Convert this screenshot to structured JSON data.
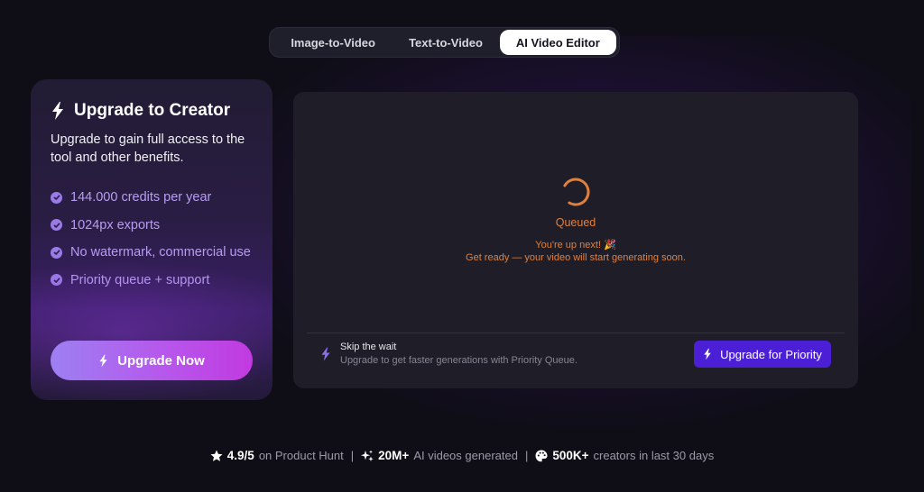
{
  "tabs": [
    {
      "label": "Image-to-Video"
    },
    {
      "label": "Text-to-Video"
    },
    {
      "label": "AI Video Editor",
      "active": true
    }
  ],
  "upsell": {
    "title": "Upgrade to Creator",
    "description": "Upgrade to gain full access to the tool and other benefits.",
    "benefits": [
      "144.000 credits per year",
      "1024px exports",
      "No watermark, commercial use",
      "Priority queue + support"
    ],
    "button_label": "Upgrade Now"
  },
  "queue": {
    "status": "Queued",
    "line1": "You're up next! 🎉",
    "line2": "Get ready — your video will start generating soon.",
    "skip_title": "Skip the wait",
    "skip_subtitle": "Upgrade to get faster generations with Priority Queue.",
    "priority_button": "Upgrade for Priority"
  },
  "stats": [
    {
      "value": "4.9/5",
      "text": "on Product Hunt",
      "icon": "star-icon"
    },
    {
      "value": "20M+",
      "text": "AI videos generated",
      "icon": "sparkle-icon"
    },
    {
      "value": "500K+",
      "text": "creators in last 30 days",
      "icon": "palette-icon"
    }
  ],
  "colors": {
    "background": "#0f0e17",
    "accent_orange": "#e0803f",
    "priority_purple": "#4b1fd6",
    "benefit_text": "#b79cf2"
  }
}
